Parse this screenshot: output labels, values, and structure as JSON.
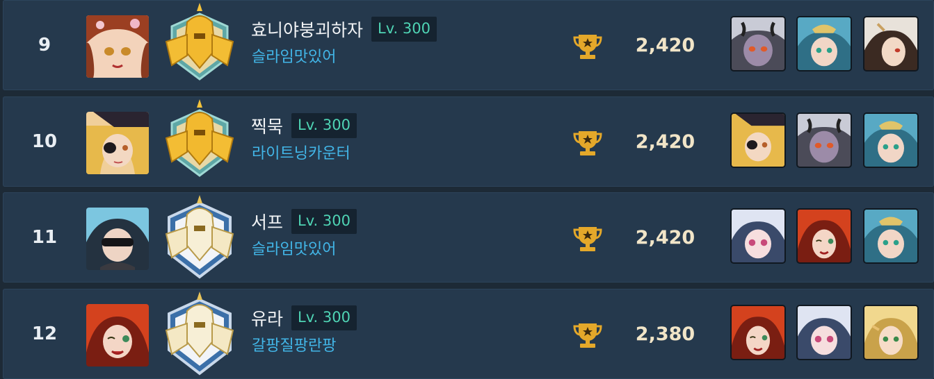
{
  "rows": [
    {
      "rank": "9",
      "avatar": "auburn-hair-girl-portrait",
      "badge": "gold-knight-emblem",
      "name": "효니야붕괴하자",
      "level": "Lv. 300",
      "guild": "슬라임맛있어",
      "trophy_icon": "trophy-icon",
      "score": "2,420",
      "heroes": [
        "dark-horned-girl-portrait",
        "blue-hair-tiara-portrait",
        "white-hair-elf-portrait"
      ]
    },
    {
      "rank": "10",
      "avatar": "blonde-eyepatch-pirate-portrait",
      "badge": "gold-knight-emblem",
      "name": "찍묵",
      "level": "Lv. 300",
      "guild": "라이트닝카운터",
      "trophy_icon": "trophy-icon",
      "score": "2,420",
      "heroes": [
        "blonde-eyepatch-pirate-portrait",
        "dark-horned-girl-portrait",
        "blue-hair-tiara-portrait"
      ]
    },
    {
      "rank": "11",
      "avatar": "blue-hair-sunglasses-portrait",
      "badge": "silver-knight-emblem",
      "name": "서프",
      "level": "Lv. 300",
      "guild": "슬라임맛있어",
      "trophy_icon": "trophy-icon",
      "score": "2,420",
      "heroes": [
        "silver-hair-girl-portrait",
        "red-hair-wink-portrait",
        "blue-hair-tiara-portrait"
      ]
    },
    {
      "rank": "12",
      "avatar": "red-hair-wink-portrait",
      "badge": "silver-knight-emblem",
      "name": "유라",
      "level": "Lv. 300",
      "guild": "갈팡질팡란팡",
      "trophy_icon": "trophy-icon",
      "score": "2,380",
      "heroes": [
        "red-hair-wink-portrait",
        "silver-hair-girl-portrait",
        "blonde-elf-portrait"
      ]
    }
  ],
  "colors": {
    "row_bg": "#25394d",
    "page_bg": "#1d2a36",
    "level_text": "#4fd4b4",
    "guild_text": "#42b6e8",
    "score_text": "#f1e5c8",
    "trophy": "#e4a82a"
  }
}
